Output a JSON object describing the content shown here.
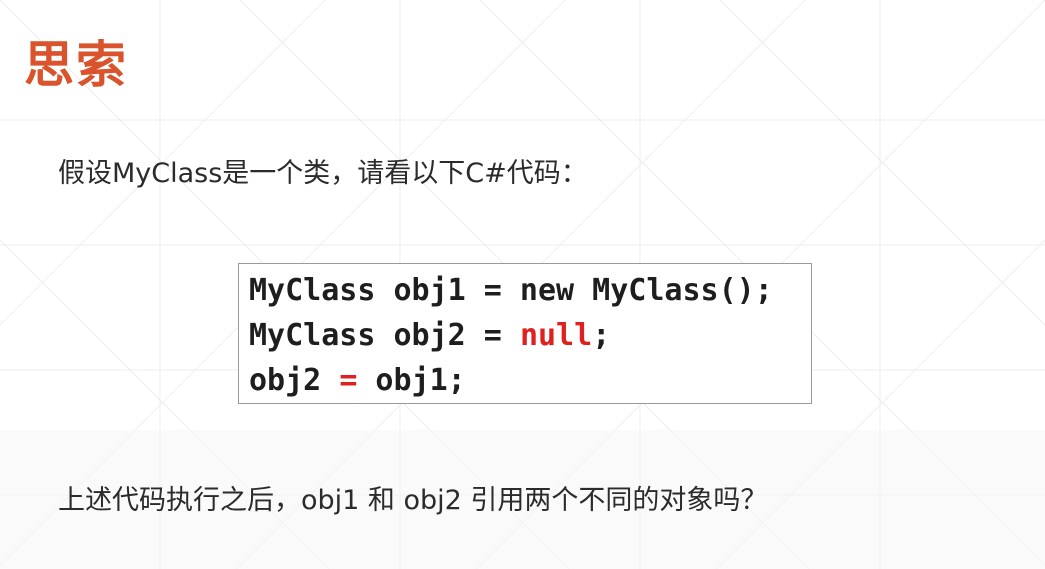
{
  "slide": {
    "title": "思索",
    "intro": "假设MyClass是一个类，请看以下C#代码：",
    "question": "上述代码执行之后，obj1 和 obj2 引用两个不同的对象吗？"
  },
  "code": {
    "line1": "MyClass obj1 = new MyClass();",
    "line2_prefix": "MyClass obj2 = ",
    "line2_keyword": "null",
    "line2_suffix": ";",
    "line3_prefix": "obj2 ",
    "line3_operator": "=",
    "line3_suffix": " obj1;"
  },
  "colors": {
    "title": "#d9532c",
    "code_keyword": "#e02020",
    "text": "#2b2b2b"
  }
}
